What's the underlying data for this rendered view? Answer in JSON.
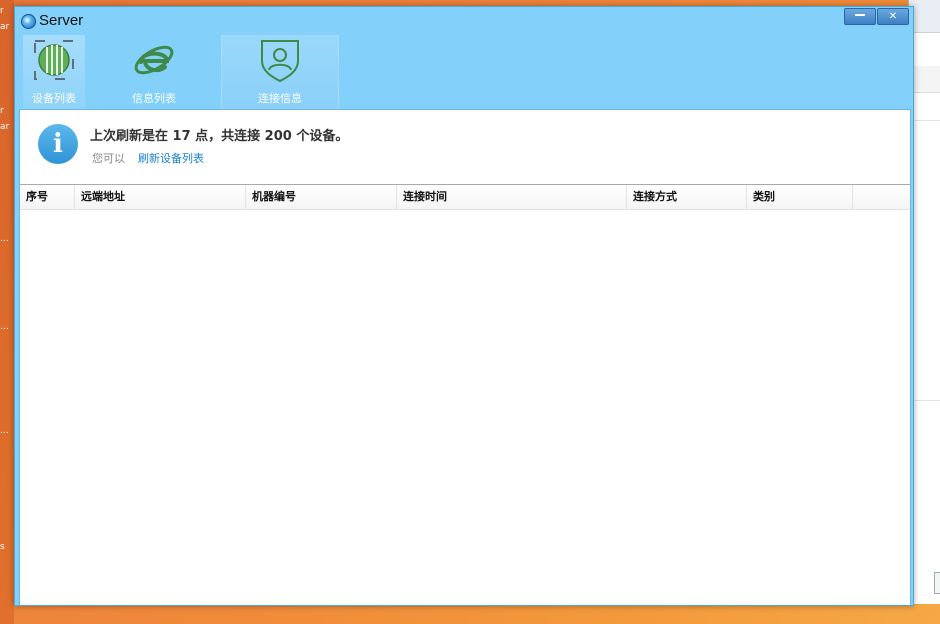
{
  "window": {
    "title": "Server"
  },
  "toolbar": {
    "tabs": [
      {
        "label": "设备列表",
        "icon": "device-grid-icon"
      },
      {
        "label": "信息列表",
        "icon": "internet-explorer-icon"
      },
      {
        "label": "连接信息",
        "icon": "user-shield-icon"
      }
    ]
  },
  "info": {
    "icon": "info-icon",
    "icon_glyph": "i",
    "message": "上次刷新是在 17 点，共连接 200 个设备。",
    "hint_prefix": "您可以",
    "link_text": "刷新设备列表"
  },
  "table": {
    "columns": [
      "序号",
      "远端地址",
      "机器编号",
      "连接时间",
      "连接方式",
      "类别"
    ],
    "rows": []
  },
  "colors": {
    "window_bg": "#83d0fb",
    "accent_blue": "#2f93d7",
    "link": "#1a83d1",
    "icon_green": "#4a9a4a",
    "desktop_orange": "#f08a3a"
  }
}
